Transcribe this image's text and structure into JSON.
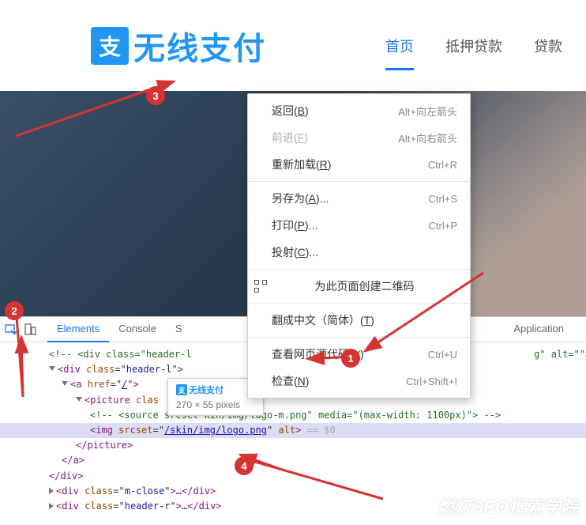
{
  "header": {
    "logo_icon": "支",
    "logo_text": "无线支付",
    "nav": [
      {
        "label": "首页"
      },
      {
        "label": "抵押贷款"
      },
      {
        "label": "贷款"
      }
    ]
  },
  "context_menu": [
    {
      "type": "item",
      "label": "返回(",
      "u": "B",
      "tail": ")",
      "shortcut": "Alt+向左箭头"
    },
    {
      "type": "item",
      "label": "前进(",
      "u": "F",
      "tail": ")",
      "shortcut": "Alt+向右箭头",
      "disabled": true
    },
    {
      "type": "item",
      "label": "重新加载(",
      "u": "R",
      "tail": ")",
      "shortcut": "Ctrl+R"
    },
    {
      "type": "sep"
    },
    {
      "type": "item",
      "label": "另存为(",
      "u": "A",
      "tail": ")...",
      "shortcut": "Ctrl+S"
    },
    {
      "type": "item",
      "label": "打印(",
      "u": "P",
      "tail": ")...",
      "shortcut": "Ctrl+P"
    },
    {
      "type": "item",
      "label": "投射(",
      "u": "C",
      "tail": ")...",
      "shortcut": ""
    },
    {
      "type": "sep"
    },
    {
      "type": "icon-item",
      "label": "为此页面创建二维码"
    },
    {
      "type": "sep"
    },
    {
      "type": "item",
      "label": "翻成中文（简体）(",
      "u": "T",
      "tail": ")",
      "shortcut": ""
    },
    {
      "type": "sep"
    },
    {
      "type": "item",
      "label": "查看网页源代码(",
      "u": "V",
      "tail": ")",
      "shortcut": "Ctrl+U"
    },
    {
      "type": "item",
      "label": "检查(",
      "u": "N",
      "tail": ")",
      "shortcut": "Ctrl+Shift+I"
    }
  ],
  "devtools": {
    "tabs": [
      "Elements",
      "Console",
      "S",
      "Application"
    ],
    "tooltip": {
      "dims": "270 × 55 pixels",
      "mini_icon": "支",
      "mini_text": "无线支付"
    },
    "lines": [
      {
        "cls": "i2",
        "html": "<span class='cmt'>&lt;!-- &lt;div class=\"header-l&nbsp;&nbsp;&nbsp;&nbsp;&nbsp;&nbsp;&nbsp;&nbsp;&nbsp;&nbsp;&nbsp;&nbsp;&nbsp;&nbsp;&nbsp;&nbsp;&nbsp;&nbsp;&nbsp;&nbsp;&nbsp;&nbsp;&nbsp;&nbsp;&nbsp;&nbsp;&nbsp;&nbsp;&nbsp;&nbsp;&nbsp;&nbsp;&nbsp;&nbsp;&nbsp;&nbsp;&nbsp;&nbsp;&nbsp;&nbsp;&nbsp;&nbsp;&nbsp;&nbsp;&nbsp;&nbsp;&nbsp;&nbsp;&nbsp;&nbsp;&nbsp;&nbsp;&nbsp;&nbsp;&nbsp;&nbsp;&nbsp;&nbsp;&nbsp;&nbsp;g\" alt=\"\"&gt;&lt;/a&gt;</span><span class='tag'>…</span>"
      },
      {
        "cls": "i2",
        "html": "<span class='caret'></span><span class='tag'>&lt;div</span> <span class='attr'>class</span>=\"<span class='val'>header-l</span>\"<span class='tag'>&gt;</span>"
      },
      {
        "cls": "i3",
        "html": "<span class='caret'></span><span class='tag'>&lt;a</span> <span class='attr'>href</span>=\"<span class='val' style='text-decoration:underline'>/</span>\"<span class='tag'>&gt;</span>"
      },
      {
        "cls": "i4",
        "html": "<span class='caret'></span><span class='tag'>&lt;picture</span> <span class='attr'>clas</span>"
      },
      {
        "cls": "i5",
        "html": "<span class='cmt'>&lt;!-- &lt;source srcset <span style='color:#236e25'>kin/img/logo-m.png\" media=\"(max-width: 1100px)\"&gt;</span> --&gt;</span>"
      },
      {
        "cls": "i5 highlight",
        "html": "<span class='tag'>&lt;img</span> <span class='attr'>srcset</span>=\"<span class='val' style='text-decoration:underline'>/skin/img/logo.png</span>\" <span class='attr'>alt</span><span class='tag'>&gt;</span> <span class='muted'>== $0</span>"
      },
      {
        "cls": "i4",
        "html": "<span class='tag'>&lt;/picture&gt;</span>"
      },
      {
        "cls": "i3",
        "html": "<span class='tag'>&lt;/a&gt;</span>"
      },
      {
        "cls": "i2",
        "html": "<span class='tag'>&lt;/div&gt;</span>"
      },
      {
        "cls": "i2",
        "html": "<span class='caretc'></span><span class='tag'>&lt;div</span> <span class='attr'>class</span>=\"<span class='val'>m-close</span>\"<span class='tag'>&gt;</span>…<span class='tag'>&lt;/div&gt;</span>"
      },
      {
        "cls": "i2",
        "html": "<span class='caretc'></span><span class='tag'>&lt;div</span> <span class='attr'>class</span>=\"<span class='val'>header-r</span>\"<span class='tag'>&gt;</span>…<span class='tag'>&lt;/div&gt;</span>"
      }
    ]
  },
  "badges": {
    "b1": "1",
    "b2": "2",
    "b3": "3",
    "b4": "4"
  },
  "watermark": "燃灯SEO搜索学院"
}
